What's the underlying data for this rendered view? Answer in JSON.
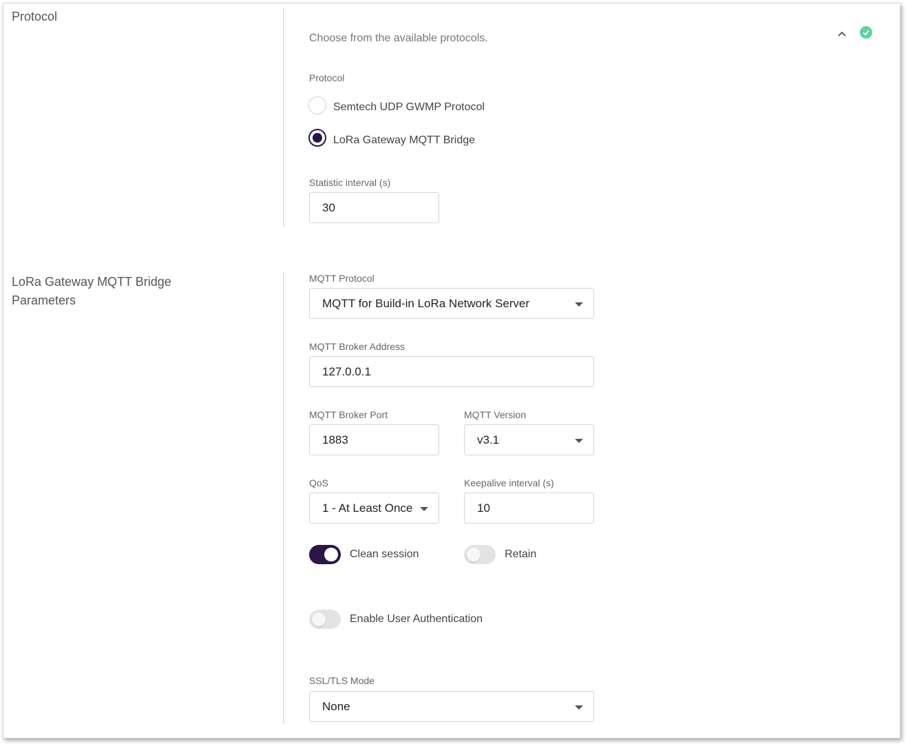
{
  "protocol_section": {
    "title": "Protocol",
    "description": "Choose from the available protocols.",
    "status_color": "#5dd39e",
    "protocol_label": "Protocol",
    "options": [
      {
        "label": "Semtech UDP GWMP Protocol",
        "selected": false
      },
      {
        "label": "LoRa Gateway MQTT Bridge",
        "selected": true
      }
    ],
    "statistic_interval_label": "Statistic interval (s)",
    "statistic_interval_value": "30"
  },
  "bridge_section": {
    "title": "LoRa Gateway MQTT Bridge Parameters",
    "mqtt_protocol_label": "MQTT Protocol",
    "mqtt_protocol_value": "MQTT for Build-in LoRa Network Server",
    "broker_address_label": "MQTT Broker Address",
    "broker_address_value": "127.0.0.1",
    "broker_port_label": "MQTT Broker Port",
    "broker_port_value": "1883",
    "mqtt_version_label": "MQTT Version",
    "mqtt_version_value": "v3.1",
    "qos_label": "QoS",
    "qos_value": "1 - At Least Once",
    "keepalive_label": "Keepalive interval (s)",
    "keepalive_value": "10",
    "clean_session_label": "Clean session",
    "clean_session_on": true,
    "retain_label": "Retain",
    "retain_on": false,
    "user_auth_label": "Enable User Authentication",
    "user_auth_on": false,
    "ssl_label": "SSL/TLS Mode",
    "ssl_value": "None"
  },
  "theme": {
    "accent": "#2d1545",
    "success": "#5dd39e"
  }
}
